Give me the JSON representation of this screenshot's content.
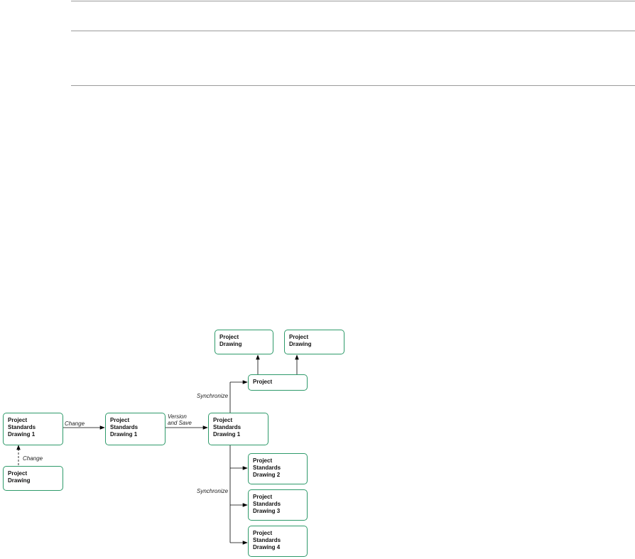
{
  "nodes": {
    "n1": [
      "Project",
      "Standards",
      "Drawing 1"
    ],
    "n2": [
      "Project",
      "Drawing"
    ],
    "n3": [
      "Project",
      "Standards",
      "Drawing 1"
    ],
    "n4": [
      "Project",
      "Standards",
      "Drawing 1"
    ],
    "n5": [
      "Project"
    ],
    "n6": [
      "Project",
      "Drawing"
    ],
    "n7": [
      "Project",
      "Drawing"
    ],
    "n8": [
      "Project",
      "Standards",
      "Drawing 2"
    ],
    "n9": [
      "Project",
      "Standards",
      "Drawing 3"
    ],
    "n10": [
      "Project",
      "Standards",
      "Drawing 4"
    ]
  },
  "labels": {
    "change_right": [
      "Change"
    ],
    "change_up": [
      "Change"
    ],
    "version_save": [
      "Version",
      "and Save"
    ],
    "sync_top": [
      "Synchronize"
    ],
    "sync_bottom": [
      "Synchronize"
    ]
  },
  "colors": {
    "node_border": "#2e9a6a",
    "line": "#000000",
    "rule": "#9a9a9a"
  }
}
